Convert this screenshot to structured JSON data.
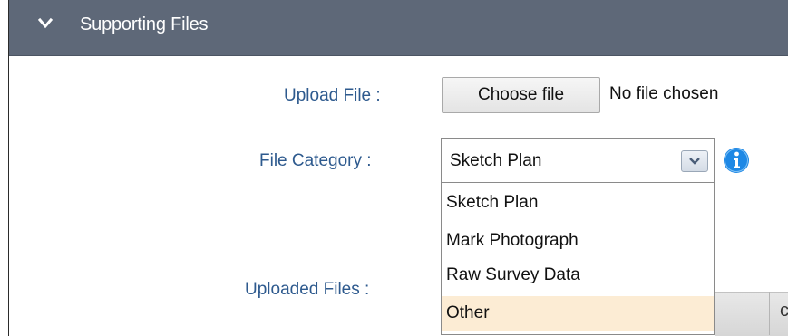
{
  "panel": {
    "title": "Supporting Files",
    "header_color": "#5e6878",
    "expanded_icon": "chevron-down-icon"
  },
  "upload": {
    "label": "Upload File :",
    "button_label": "Choose file",
    "status": "No file chosen"
  },
  "category": {
    "label": "File Category :",
    "selected": "Sketch Plan",
    "info_icon": "info-icon",
    "options": [
      {
        "label": "Sketch Plan",
        "highlighted": false
      },
      {
        "label": "Mark Photograph",
        "highlighted": false
      },
      {
        "label": "Raw Survey Data",
        "highlighted": false
      },
      {
        "label": "Other",
        "highlighted": true
      }
    ]
  },
  "uploaded": {
    "label": "Uploaded Files :"
  },
  "colors": {
    "label_text": "#2e5a8e",
    "option_highlight": "#fcecd4",
    "info_blue": "#1e88e5"
  }
}
